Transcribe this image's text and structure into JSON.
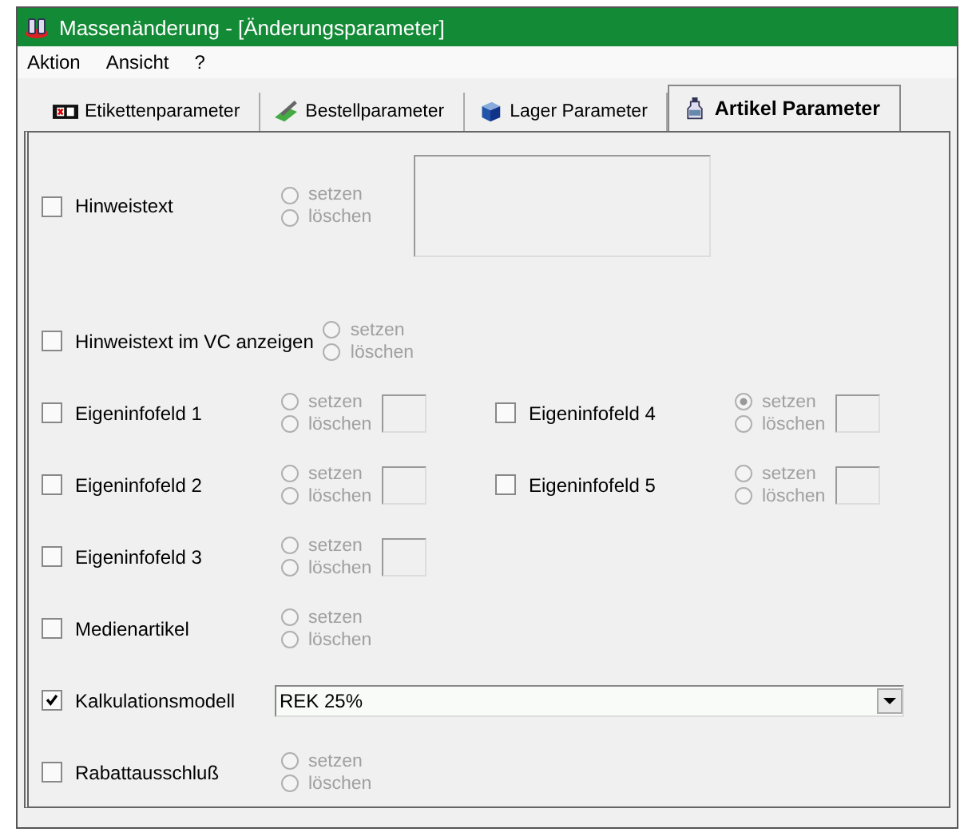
{
  "window": {
    "title": "Massenänderung - [Änderungsparameter]"
  },
  "menu": [
    "Aktion",
    "Ansicht",
    "?"
  ],
  "tabs": [
    {
      "label": "Etikettenparameter",
      "selected": false,
      "kind": "label"
    },
    {
      "label": "Bestellparameter",
      "selected": false,
      "kind": "order"
    },
    {
      "label": "Lager Parameter",
      "selected": false,
      "kind": "box"
    },
    {
      "label": "Artikel Parameter",
      "selected": true,
      "kind": "bottle"
    }
  ],
  "rows": [
    {
      "fields": [
        {
          "kind": "radio",
          "label": "Hinweistext",
          "checked": false,
          "textbox": {
            "kind": "large"
          },
          "radios": [
            {
              "label": "setzen",
              "selected": false
            },
            {
              "label": "löschen",
              "selected": false
            }
          ]
        }
      ]
    },
    {
      "fields": [
        {
          "kind": "radio",
          "label": "Hinweistext im VC anzeigen",
          "checked": false,
          "radios": [
            {
              "label": "setzen",
              "selected": false
            },
            {
              "label": "löschen",
              "selected": false
            }
          ]
        }
      ]
    },
    {
      "fields": [
        {
          "kind": "radio",
          "label": "Eigeninfofeld 1",
          "checked": false,
          "textbox": {
            "kind": "small"
          },
          "radios": [
            {
              "label": "setzen",
              "selected": false
            },
            {
              "label": "löschen",
              "selected": false
            }
          ]
        },
        {
          "kind": "radio",
          "label": "Eigeninfofeld 4",
          "checked": false,
          "textbox": {
            "kind": "small"
          },
          "radios": [
            {
              "label": "setzen",
              "selected": true
            },
            {
              "label": "löschen",
              "selected": false
            }
          ]
        }
      ]
    },
    {
      "fields": [
        {
          "kind": "radio",
          "label": "Eigeninfofeld 2",
          "checked": false,
          "textbox": {
            "kind": "small"
          },
          "radios": [
            {
              "label": "setzen",
              "selected": false
            },
            {
              "label": "löschen",
              "selected": false
            }
          ]
        },
        {
          "kind": "radio",
          "label": "Eigeninfofeld 5",
          "checked": false,
          "textbox": {
            "kind": "small"
          },
          "radios": [
            {
              "label": "setzen",
              "selected": false
            },
            {
              "label": "löschen",
              "selected": false
            }
          ]
        }
      ]
    },
    {
      "fields": [
        {
          "kind": "radio",
          "label": "Eigeninfofeld 3",
          "checked": false,
          "textbox": {
            "kind": "small"
          },
          "radios": [
            {
              "label": "setzen",
              "selected": false
            },
            {
              "label": "löschen",
              "selected": false
            }
          ]
        }
      ]
    },
    {
      "fields": [
        {
          "kind": "radio",
          "label": "Medienartikel",
          "checked": false,
          "radios": [
            {
              "label": "setzen",
              "selected": false
            },
            {
              "label": "löschen",
              "selected": false
            }
          ]
        }
      ]
    },
    {
      "fields": [
        {
          "kind": "combo",
          "label": "Kalkulationsmodell",
          "checked": true,
          "value": "REK 25%"
        }
      ]
    },
    {
      "fields": [
        {
          "kind": "radio",
          "label": "Rabattausschluß",
          "checked": false,
          "radios": [
            {
              "label": "setzen",
              "selected": false
            },
            {
              "label": "löschen",
              "selected": false
            }
          ]
        }
      ]
    }
  ]
}
